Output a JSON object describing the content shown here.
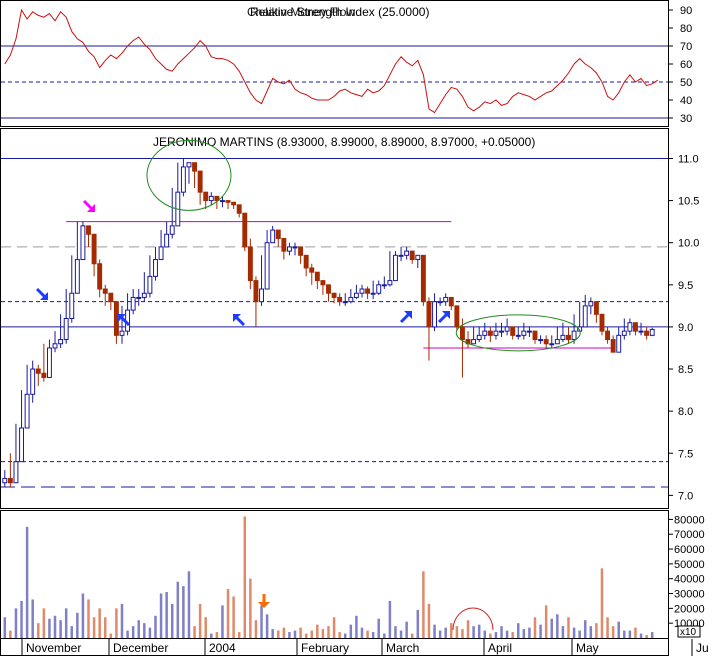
{
  "colors": {
    "frame": "#000000",
    "level_line": "#1a1aa0",
    "rsi_line": "#cc1111",
    "up_body": "#ffffff",
    "up_outline": "#1a1aa0",
    "down_body": "#a52a00",
    "resistance": "#cc00cc",
    "support": "#cc00cc",
    "circle": "#228b22",
    "arrow_blue": "#1e3cff",
    "arrow_magenta": "#ff00ff",
    "arrow_orange": "#ff6a00",
    "vol_up": "#8080c8",
    "vol_down": "#e08a6a",
    "vol_arc": "#d02020",
    "grid_dash": "#9a9aa0"
  },
  "chart_data": [
    {
      "type": "line",
      "panel": "indicator",
      "title": "Relative Strength Index (25.0000)",
      "title_overlap": "Chaikin Money Flow",
      "ylim": [
        25,
        95
      ],
      "yticks": [
        30,
        40,
        50,
        60,
        70,
        80,
        90
      ],
      "levels": [
        30,
        50,
        70
      ],
      "series": [
        {
          "name": "RSI",
          "values": [
            60,
            65,
            74,
            90,
            85,
            89,
            87,
            86,
            88,
            84,
            89,
            86,
            78,
            74,
            72,
            67,
            64,
            58,
            62,
            65,
            63,
            66,
            70,
            73,
            75,
            71,
            68,
            63,
            60,
            57,
            56,
            60,
            63,
            66,
            69,
            73,
            70,
            64,
            63,
            63,
            62,
            60,
            56,
            50,
            44,
            40,
            38,
            45,
            52,
            50,
            49,
            51,
            46,
            44,
            43,
            41,
            40,
            40,
            40,
            42,
            45,
            46,
            44,
            43,
            42,
            46,
            44,
            45,
            48,
            54,
            60,
            64,
            61,
            59,
            62,
            54,
            35,
            33,
            38,
            43,
            47,
            46,
            42,
            36,
            34,
            36,
            39,
            38,
            40,
            37,
            38,
            42,
            44,
            43,
            42,
            40,
            42,
            44,
            45,
            48,
            51,
            55,
            60,
            63,
            60,
            58,
            55,
            50,
            42,
            40,
            44,
            50,
            54,
            50,
            52,
            48,
            49,
            51
          ]
        }
      ]
    },
    {
      "type": "candlestick",
      "panel": "price",
      "title": "JERONIMO MARTINS (8.93000, 8.99000, 8.89000, 8.97000, +0.05000)",
      "ylim": [
        6.85,
        11.35
      ],
      "yticks": [
        "7.0",
        "7.5",
        "8.0",
        "8.5",
        "9.0",
        "9.5",
        "10.0",
        "10.5",
        "11.0"
      ],
      "closes": [
        7.2,
        7.15,
        7.4,
        7.8,
        8.2,
        8.5,
        8.45,
        8.4,
        8.75,
        8.8,
        8.85,
        9.1,
        9.4,
        9.8,
        10.2,
        10.1,
        9.75,
        9.45,
        9.4,
        9.3,
        8.9,
        8.95,
        9.2,
        9.35,
        9.35,
        9.4,
        9.6,
        9.8,
        9.95,
        10.1,
        10.2,
        10.6,
        10.9,
        10.95,
        10.85,
        10.6,
        10.5,
        10.55,
        10.5,
        10.5,
        10.48,
        10.45,
        10.35,
        9.95,
        9.55,
        9.3,
        9.45,
        10.0,
        10.15,
        10.05,
        9.9,
        9.95,
        9.95,
        9.85,
        9.7,
        9.65,
        9.55,
        9.5,
        9.4,
        9.35,
        9.3,
        9.3,
        9.35,
        9.4,
        9.45,
        9.4,
        9.4,
        9.5,
        9.5,
        9.55,
        9.85,
        9.85,
        9.9,
        9.8,
        9.85,
        9.3,
        9.0,
        9.3,
        9.3,
        9.35,
        9.25,
        9.0,
        8.85,
        8.8,
        8.85,
        8.9,
        8.95,
        8.9,
        8.95,
        8.95,
        9.0,
        8.9,
        8.9,
        8.95,
        8.95,
        8.85,
        8.85,
        8.8,
        8.8,
        8.85,
        8.9,
        8.85,
        8.95,
        9.0,
        9.25,
        9.3,
        9.15,
        8.95,
        8.85,
        8.7,
        8.9,
        8.95,
        9.05,
        8.95,
        8.95,
        8.9,
        8.97
      ],
      "lows": [
        7.1,
        7.1,
        7.15,
        7.4,
        7.8,
        8.1,
        8.3,
        8.35,
        8.45,
        8.7,
        8.75,
        8.8,
        9.05,
        9.4,
        9.8,
        9.95,
        9.6,
        9.35,
        9.25,
        9.2,
        8.8,
        8.8,
        8.9,
        9.15,
        9.25,
        9.3,
        9.35,
        9.55,
        9.8,
        9.95,
        10.05,
        10.2,
        10.55,
        10.7,
        10.65,
        10.45,
        10.4,
        10.45,
        10.4,
        10.42,
        10.4,
        10.4,
        10.3,
        9.9,
        9.45,
        9.0,
        9.25,
        9.45,
        10.0,
        9.95,
        9.8,
        9.85,
        9.85,
        9.75,
        9.6,
        9.5,
        9.45,
        9.38,
        9.3,
        9.28,
        9.25,
        9.25,
        9.28,
        9.33,
        9.35,
        9.33,
        9.33,
        9.38,
        9.45,
        9.48,
        9.55,
        9.78,
        9.8,
        9.75,
        9.7,
        9.25,
        8.6,
        8.95,
        9.25,
        9.25,
        9.2,
        8.95,
        8.4,
        8.75,
        8.8,
        8.82,
        8.85,
        8.82,
        8.85,
        8.88,
        8.9,
        8.85,
        8.85,
        8.85,
        8.88,
        8.8,
        8.8,
        8.75,
        8.75,
        8.8,
        8.82,
        8.8,
        8.8,
        8.95,
        9.15,
        9.15,
        9.05,
        8.9,
        8.8,
        8.7,
        8.7,
        8.85,
        8.9,
        8.9,
        8.9,
        8.85,
        8.89
      ],
      "highs": [
        7.3,
        7.5,
        7.85,
        8.25,
        8.55,
        8.6,
        8.55,
        8.8,
        8.85,
        8.95,
        9.15,
        9.45,
        9.85,
        10.25,
        10.25,
        10.15,
        10.1,
        9.8,
        9.5,
        9.4,
        9.3,
        9.25,
        9.4,
        9.45,
        9.45,
        9.65,
        9.85,
        9.95,
        10.15,
        10.25,
        10.65,
        10.95,
        11.0,
        10.95,
        10.9,
        10.65,
        10.6,
        10.6,
        10.55,
        10.55,
        10.5,
        10.45,
        10.35,
        10.35,
        10.05,
        9.6,
        9.85,
        10.15,
        10.2,
        10.15,
        10.0,
        10.0,
        10.0,
        9.95,
        9.8,
        9.75,
        9.6,
        9.55,
        9.45,
        9.4,
        9.4,
        9.4,
        9.45,
        9.5,
        9.5,
        9.48,
        9.55,
        9.55,
        9.6,
        9.9,
        9.9,
        9.95,
        9.95,
        9.9,
        9.85,
        9.6,
        9.35,
        9.4,
        9.35,
        9.4,
        9.3,
        9.0,
        9.1,
        8.95,
        9.0,
        9.0,
        9.05,
        9.0,
        9.05,
        9.05,
        9.1,
        9.0,
        9.0,
        9.05,
        9.0,
        8.95,
        8.9,
        8.9,
        8.9,
        9.0,
        9.05,
        9.0,
        9.15,
        9.3,
        9.38,
        9.35,
        9.3,
        9.15,
        9.0,
        8.9,
        9.0,
        9.1,
        9.1,
        9.05,
        9.05,
        9.0,
        8.99
      ],
      "horizontal_lines": [
        {
          "name": "resistance",
          "y": 10.25,
          "style": "solid",
          "color": "#cc00cc"
        },
        {
          "name": "support",
          "y": 8.75,
          "style": "solid",
          "color": "#cc00cc"
        },
        {
          "name": "level",
          "y": 11.0,
          "style": "solid",
          "color": "#1a1aa0"
        },
        {
          "name": "level",
          "y": 9.0,
          "style": "solid",
          "color": "#1a1aa0"
        },
        {
          "name": "level",
          "y": 9.3,
          "style": "dashed",
          "color": "#1a1aa0"
        },
        {
          "name": "level",
          "y": 7.4,
          "style": "dashed",
          "color": "#1a1aa0"
        },
        {
          "name": "level",
          "y": 7.1,
          "style": "long-dash",
          "color": "#1a1aa0"
        },
        {
          "name": "grid",
          "y": 9.95,
          "style": "dashed",
          "color": "#9a9aa0"
        }
      ]
    },
    {
      "type": "bar",
      "panel": "volume",
      "ylim": [
        0,
        85000
      ],
      "yticks": [
        "10000",
        "20000",
        "30000",
        "40000",
        "50000",
        "60000",
        "70000",
        "80000"
      ],
      "axis_multiplier": "x10",
      "x_labels": [
        "November",
        "December",
        "2004",
        "February",
        "March",
        "April",
        "May",
        "Ju"
      ],
      "values": [
        14000,
        5000,
        20000,
        25000,
        75000,
        26000,
        10000,
        20000,
        13000,
        15000,
        12000,
        20000,
        8000,
        17000,
        30000,
        26000,
        14000,
        20000,
        14000,
        3000,
        20000,
        23000,
        5000,
        8000,
        12000,
        10000,
        7000,
        15000,
        30000,
        31000,
        23000,
        38000,
        35000,
        45000,
        8000,
        23000,
        14000,
        3000,
        4000,
        22000,
        33000,
        28000,
        4000,
        82000,
        40000,
        12000,
        22000,
        16000,
        6000,
        5000,
        7000,
        4000,
        5000,
        7000,
        3000,
        5000,
        9000,
        6000,
        8000,
        14000,
        4000,
        3000,
        9000,
        15000,
        7000,
        5000,
        4000,
        13000,
        3000,
        25000,
        8000,
        5000,
        11000,
        3000,
        19000,
        45000,
        23000,
        9000,
        5000,
        7000,
        10000,
        8000,
        6000,
        12000,
        8000,
        9000,
        5000,
        3000,
        4000,
        8000,
        5000,
        4000,
        10000,
        6000,
        7000,
        14000,
        9000,
        22000,
        13000,
        16000,
        8000,
        14000,
        7000,
        5000,
        12000,
        8000,
        10000,
        47000,
        14000,
        8000,
        11000,
        5000,
        5000,
        7000,
        3000,
        2000,
        4000
      ],
      "annotations": []
    }
  ]
}
